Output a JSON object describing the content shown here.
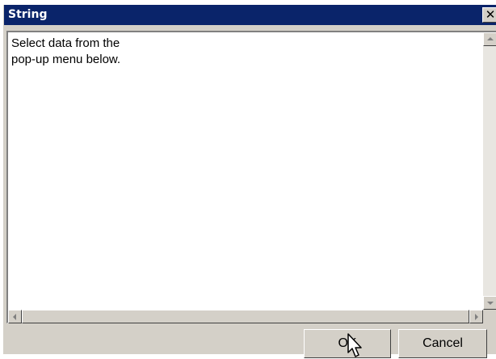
{
  "window": {
    "title": "String",
    "close_glyph": "✕"
  },
  "text_area": {
    "content": "Select data from the\npop-up menu below."
  },
  "buttons": {
    "ok_label": "OK",
    "cancel_label": "Cancel"
  },
  "colors": {
    "titlebar": "#0a246a",
    "dialog_face": "#d4d0c8"
  },
  "icons": {
    "close": "close-icon",
    "scroll_up": "arrow-up-icon",
    "scroll_down": "arrow-down-icon",
    "scroll_left": "arrow-left-icon",
    "scroll_right": "arrow-right-icon",
    "cursor": "mouse-pointer-icon"
  }
}
